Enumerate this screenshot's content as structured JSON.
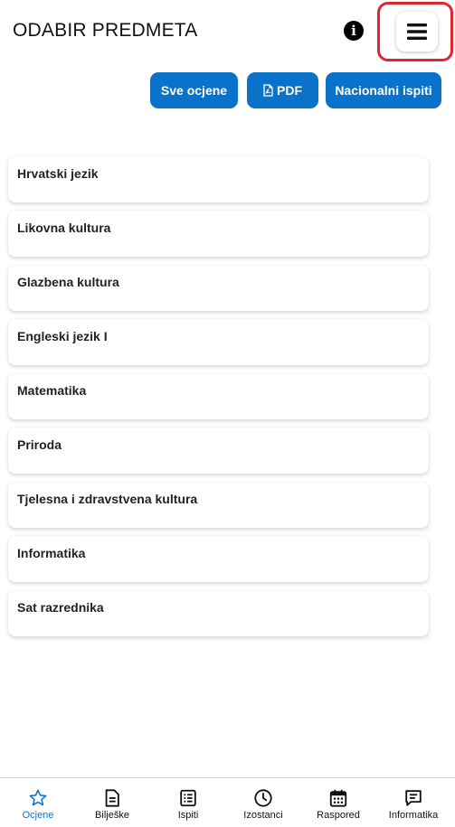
{
  "header": {
    "title": "ODABIR PREDMETA"
  },
  "actions": {
    "sve_ocjene": "Sve ocjene",
    "pdf": "PDF",
    "nacionalni_ispiti": "Nacionalni ispiti"
  },
  "subjects": [
    "Hrvatski jezik",
    "Likovna kultura",
    "Glazbena kultura",
    "Engleski jezik I",
    "Matematika",
    "Priroda",
    "Tjelesna i zdravstvena kultura",
    "Informatika",
    "Sat razrednika"
  ],
  "nav": [
    {
      "label": "Ocjene",
      "icon": "star-icon",
      "active": true
    },
    {
      "label": "Bilješke",
      "icon": "notes-icon",
      "active": false
    },
    {
      "label": "Ispiti",
      "icon": "list-icon",
      "active": false
    },
    {
      "label": "Izostanci",
      "icon": "clock-icon",
      "active": false
    },
    {
      "label": "Raspored",
      "icon": "calendar-icon",
      "active": false
    },
    {
      "label": "Informatika",
      "icon": "chat-icon",
      "active": false
    }
  ],
  "colors": {
    "primary": "#0a72c9",
    "highlight": "#e0262b",
    "text": "#1a1a1a"
  }
}
